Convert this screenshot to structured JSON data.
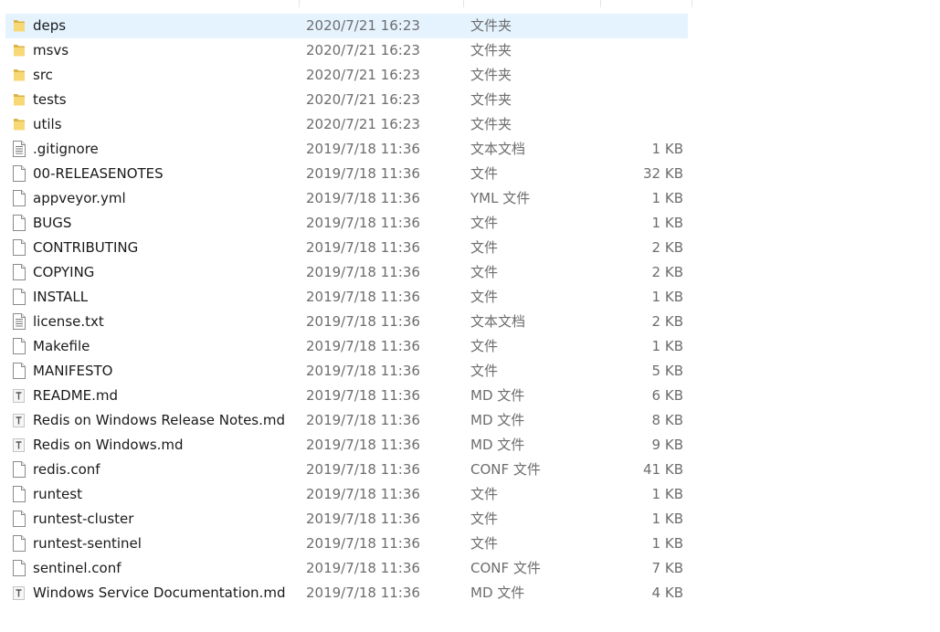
{
  "files": [
    {
      "name": "deps",
      "date": "2020/7/21 16:23",
      "type": "文件夹",
      "size": "",
      "icon": "folder-icon",
      "selected": true
    },
    {
      "name": "msvs",
      "date": "2020/7/21 16:23",
      "type": "文件夹",
      "size": "",
      "icon": "folder-icon"
    },
    {
      "name": "src",
      "date": "2020/7/21 16:23",
      "type": "文件夹",
      "size": "",
      "icon": "folder-icon"
    },
    {
      "name": "tests",
      "date": "2020/7/21 16:23",
      "type": "文件夹",
      "size": "",
      "icon": "folder-icon"
    },
    {
      "name": "utils",
      "date": "2020/7/21 16:23",
      "type": "文件夹",
      "size": "",
      "icon": "folder-icon"
    },
    {
      "name": ".gitignore",
      "date": "2019/7/18 11:36",
      "type": "文本文档",
      "size": "1 KB",
      "icon": "text-document-icon"
    },
    {
      "name": "00-RELEASENOTES",
      "date": "2019/7/18 11:36",
      "type": "文件",
      "size": "32 KB",
      "icon": "file-icon"
    },
    {
      "name": "appveyor.yml",
      "date": "2019/7/18 11:36",
      "type": "YML 文件",
      "size": "1 KB",
      "icon": "file-icon"
    },
    {
      "name": "BUGS",
      "date": "2019/7/18 11:36",
      "type": "文件",
      "size": "1 KB",
      "icon": "file-icon"
    },
    {
      "name": "CONTRIBUTING",
      "date": "2019/7/18 11:36",
      "type": "文件",
      "size": "2 KB",
      "icon": "file-icon"
    },
    {
      "name": "COPYING",
      "date": "2019/7/18 11:36",
      "type": "文件",
      "size": "2 KB",
      "icon": "file-icon"
    },
    {
      "name": "INSTALL",
      "date": "2019/7/18 11:36",
      "type": "文件",
      "size": "1 KB",
      "icon": "file-icon"
    },
    {
      "name": "license.txt",
      "date": "2019/7/18 11:36",
      "type": "文本文档",
      "size": "2 KB",
      "icon": "text-document-icon"
    },
    {
      "name": "Makefile",
      "date": "2019/7/18 11:36",
      "type": "文件",
      "size": "1 KB",
      "icon": "file-icon"
    },
    {
      "name": "MANIFESTO",
      "date": "2019/7/18 11:36",
      "type": "文件",
      "size": "5 KB",
      "icon": "file-icon"
    },
    {
      "name": "README.md",
      "date": "2019/7/18 11:36",
      "type": "MD 文件",
      "size": "6 KB",
      "icon": "markdown-file-icon"
    },
    {
      "name": "Redis on Windows Release Notes.md",
      "date": "2019/7/18 11:36",
      "type": "MD 文件",
      "size": "8 KB",
      "icon": "markdown-file-icon"
    },
    {
      "name": "Redis on Windows.md",
      "date": "2019/7/18 11:36",
      "type": "MD 文件",
      "size": "9 KB",
      "icon": "markdown-file-icon"
    },
    {
      "name": "redis.conf",
      "date": "2019/7/18 11:36",
      "type": "CONF 文件",
      "size": "41 KB",
      "icon": "file-icon"
    },
    {
      "name": "runtest",
      "date": "2019/7/18 11:36",
      "type": "文件",
      "size": "1 KB",
      "icon": "file-icon"
    },
    {
      "name": "runtest-cluster",
      "date": "2019/7/18 11:36",
      "type": "文件",
      "size": "1 KB",
      "icon": "file-icon"
    },
    {
      "name": "runtest-sentinel",
      "date": "2019/7/18 11:36",
      "type": "文件",
      "size": "1 KB",
      "icon": "file-icon"
    },
    {
      "name": "sentinel.conf",
      "date": "2019/7/18 11:36",
      "type": "CONF 文件",
      "size": "7 KB",
      "icon": "file-icon"
    },
    {
      "name": "Windows Service Documentation.md",
      "date": "2019/7/18 11:36",
      "type": "MD 文件",
      "size": "4 KB",
      "icon": "markdown-file-icon"
    }
  ],
  "colors": {
    "selected_row": "#e5f3ff",
    "folder": "#f8d775",
    "text_primary": "#1a1a1a",
    "text_secondary": "#6d6d6d"
  }
}
